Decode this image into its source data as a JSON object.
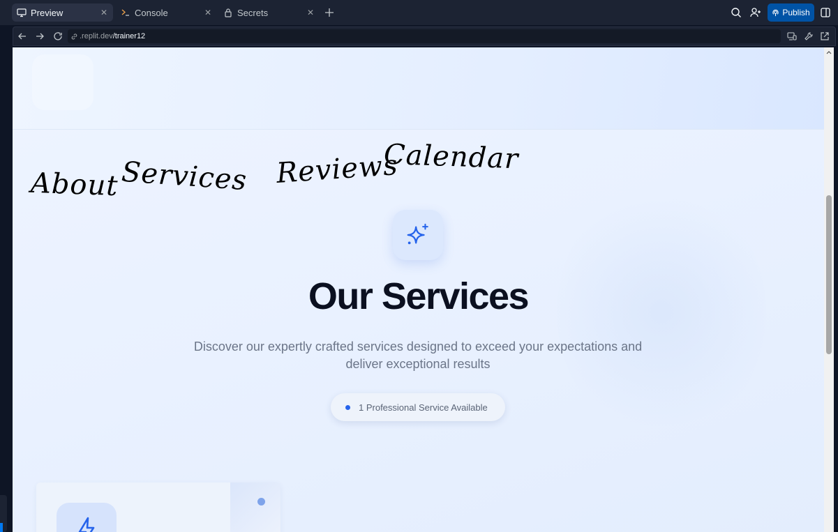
{
  "tabs": [
    {
      "label": "Preview",
      "icon": "monitor-icon",
      "active": true
    },
    {
      "label": "Console",
      "icon": "terminal-icon",
      "active": false
    },
    {
      "label": "Secrets",
      "icon": "lock-icon",
      "active": false
    }
  ],
  "toolbar": {
    "publish_label": "Publish",
    "icons": [
      "search-icon",
      "invite-user-icon",
      "split-panel-icon"
    ]
  },
  "address": {
    "host": ".replit.dev",
    "path": "/trainer12",
    "icons": [
      "back-arrow-icon",
      "forward-arrow-icon",
      "reload-icon",
      "link-icon",
      "devices-icon",
      "wrench-icon",
      "external-link-icon"
    ]
  },
  "handwritten_nav": [
    "About",
    "Services",
    "Reviews",
    "Calendar"
  ],
  "section": {
    "title": "Our Services",
    "subtitle": "Discover our expertly crafted services designed to exceed your expectations and deliver exceptional results",
    "badge_text": "1 Professional Service Available",
    "badge_color": "#2563eb"
  },
  "colors": {
    "accent": "#2563eb",
    "publish_bg": "#0053a6",
    "chrome_bg": "#1c2333"
  }
}
